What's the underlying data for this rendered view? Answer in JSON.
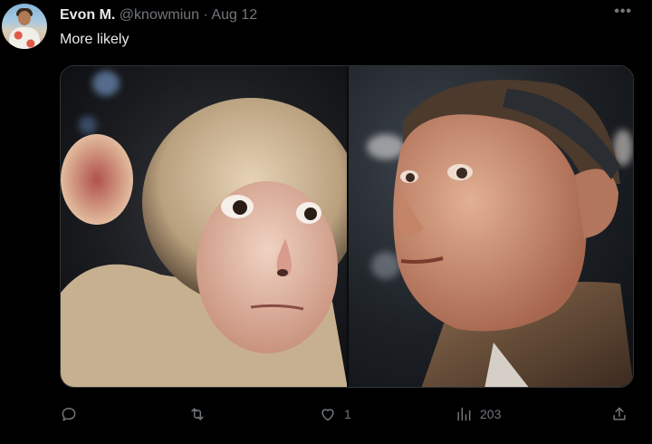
{
  "tweet": {
    "display_name": "Evon M.",
    "handle": "@knowmiun",
    "separator": "·",
    "date": "Aug 12",
    "more_label": "•••",
    "text": "More likely",
    "media": {
      "left_subject": "monkey-portrait",
      "right_subject": "man-portrait"
    },
    "actions": {
      "reply_count": "",
      "retweet_count": "",
      "like_count": "1",
      "views_count": "203"
    }
  },
  "colors": {
    "background": "#000000",
    "text_primary": "#e7e9ea",
    "text_muted": "#71767b",
    "border": "#2f3336"
  }
}
